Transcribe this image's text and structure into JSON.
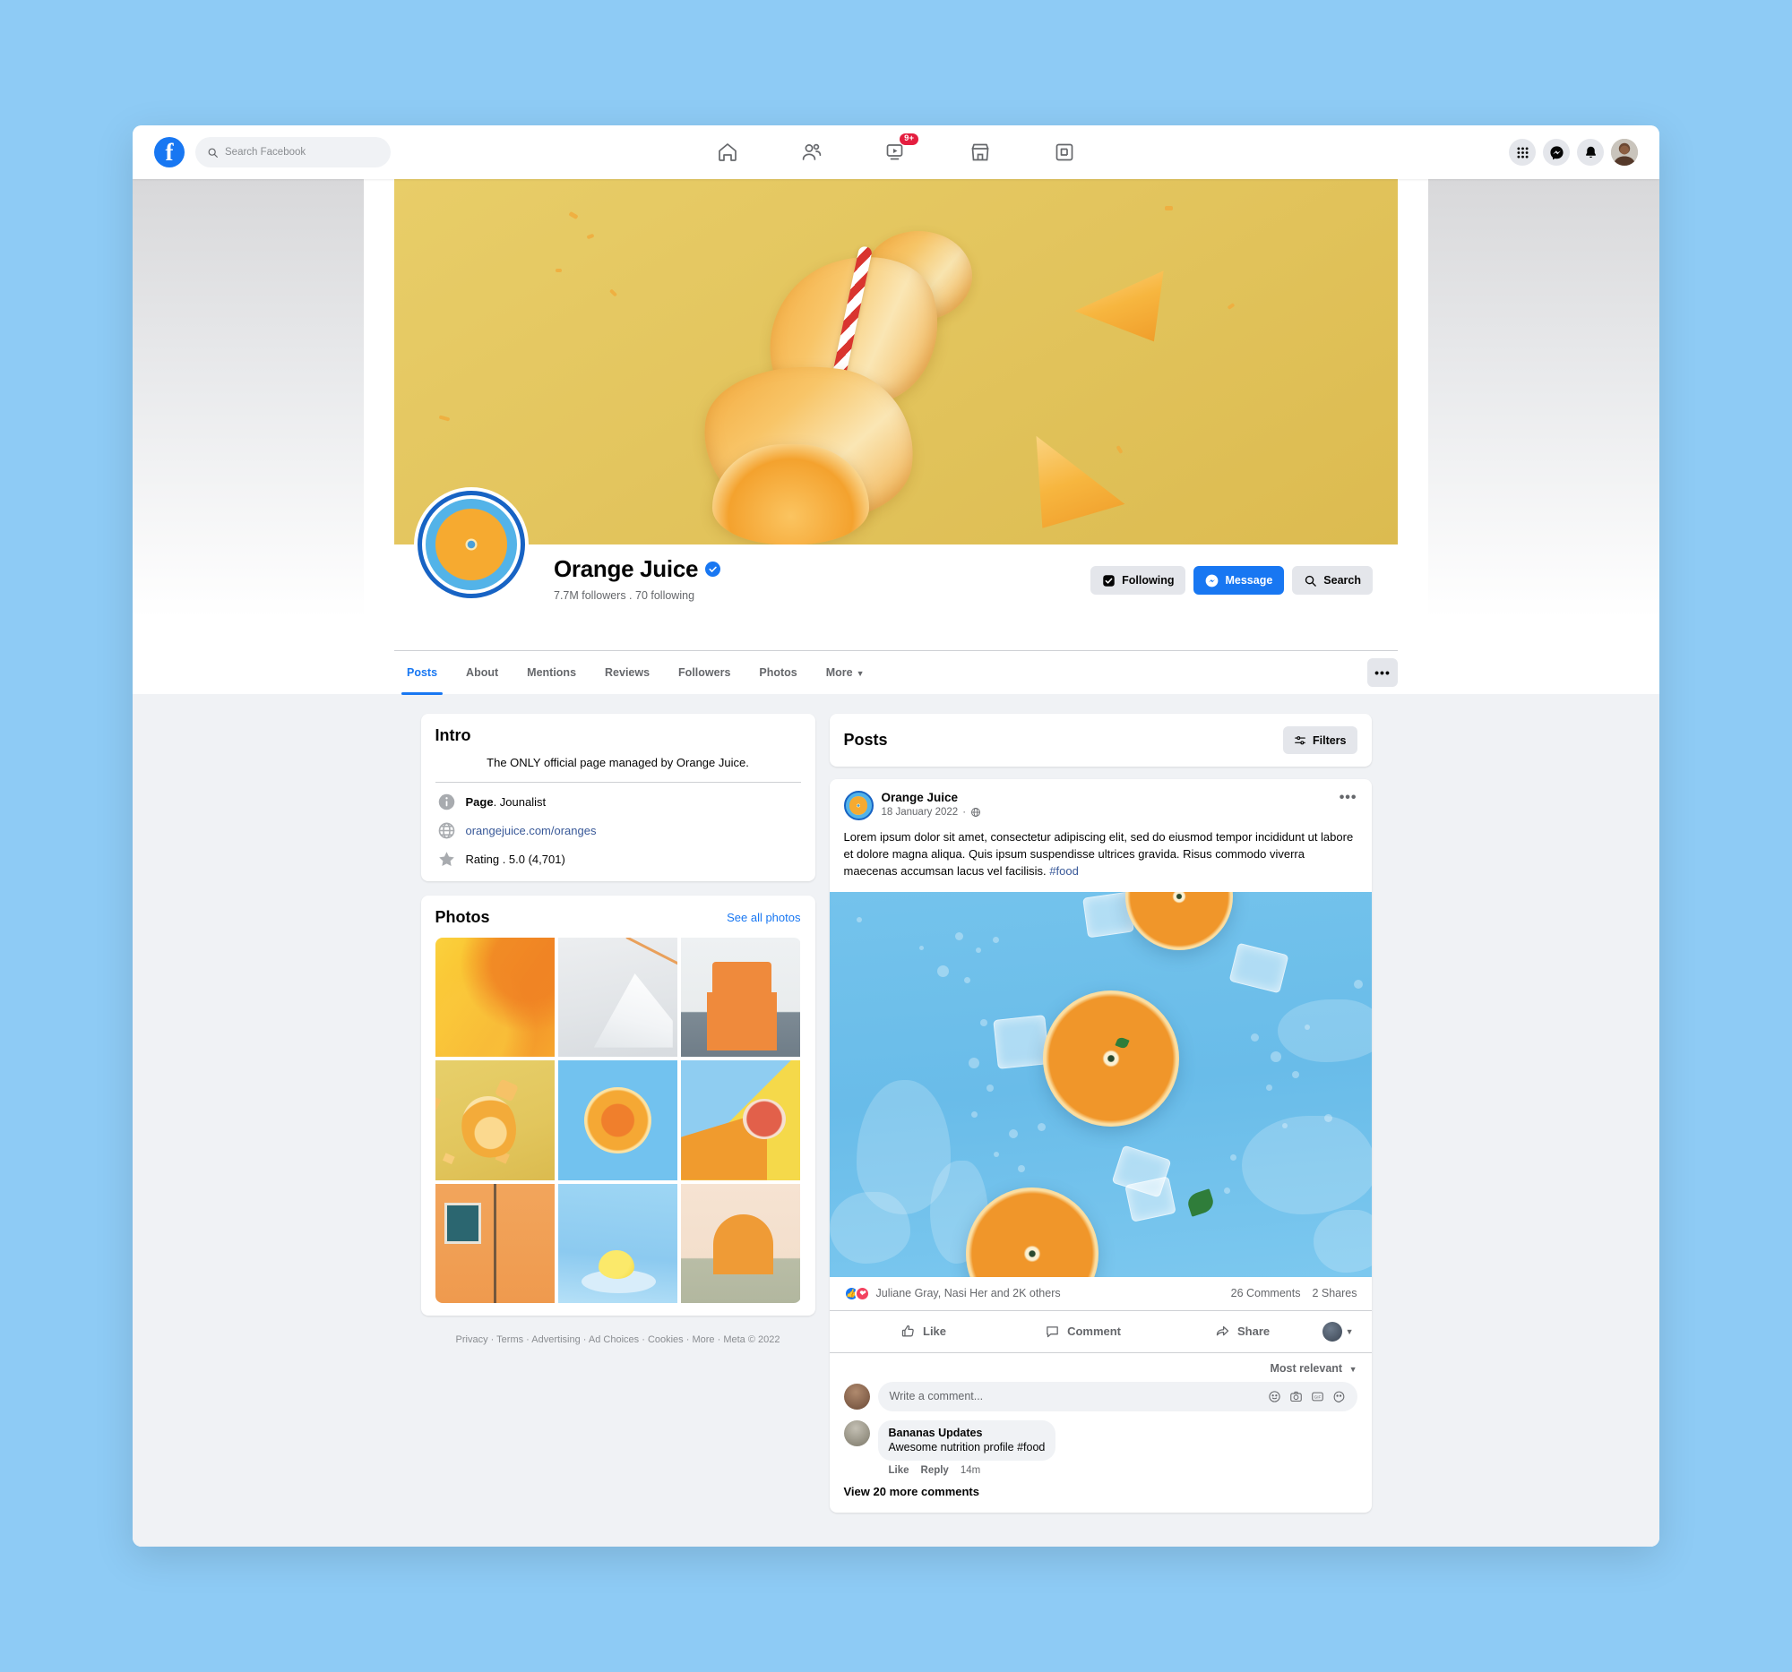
{
  "topbar": {
    "logo": "facebook-logo",
    "search_placeholder": "Search Facebook",
    "nav": [
      {
        "name": "home",
        "icon": "home-icon",
        "badge": ""
      },
      {
        "name": "friends",
        "icon": "friends-icon",
        "badge": ""
      },
      {
        "name": "watch",
        "icon": "video-icon",
        "badge": "9+"
      },
      {
        "name": "marketplace",
        "icon": "marketplace-icon",
        "badge": ""
      },
      {
        "name": "groups",
        "icon": "groups-icon",
        "badge": ""
      }
    ],
    "right": [
      {
        "name": "menu",
        "icon": "grid-menu-icon"
      },
      {
        "name": "messenger",
        "icon": "messenger-icon"
      },
      {
        "name": "notifications",
        "icon": "bell-icon"
      },
      {
        "name": "account",
        "icon": "user-avatar"
      }
    ]
  },
  "profile": {
    "name": "Orange Juice",
    "verified": true,
    "stats": "7.7M followers . 70 following",
    "buttons": {
      "following": "Following",
      "message": "Message",
      "search": "Search",
      "more": "•••"
    }
  },
  "tabs": [
    {
      "label": "Posts",
      "active": true
    },
    {
      "label": "About",
      "active": false
    },
    {
      "label": "Mentions",
      "active": false
    },
    {
      "label": "Reviews",
      "active": false
    },
    {
      "label": "Followers",
      "active": false
    },
    {
      "label": "Photos",
      "active": false
    },
    {
      "label": "More",
      "active": false,
      "caret": true
    }
  ],
  "intro": {
    "title": "Intro",
    "bio": "The ONLY official page managed by Orange Juice.",
    "category_bold": "Page",
    "category_rest": ". Jounalist",
    "website": "orangejuice.com/oranges",
    "rating": "Rating . 5.0 (4,701)"
  },
  "photos": {
    "title": "Photos",
    "see_all": "See all photos",
    "items": [
      "orange-juice-splash",
      "white-staircase-orange-railing",
      "orange-armchair",
      "orange-peel-straw-yellow",
      "orange-slice-blue",
      "grapefruit-half-yellow",
      "orange-building-teal-shutters",
      "lemon-on-plate-blue",
      "orange-semicircle-abstract"
    ]
  },
  "footer": {
    "links": [
      "Privacy",
      "Terms",
      "Advertising",
      "Ad Choices",
      "Cookies",
      "More"
    ],
    "copyright": "Meta © 2022"
  },
  "posts_panel": {
    "title": "Posts",
    "filters_label": "Filters"
  },
  "post": {
    "author": "Orange Juice",
    "date": "18 January 2022",
    "privacy": "public-globe-icon",
    "menu": "•••",
    "body": "Lorem ipsum dolor sit amet, consectetur adipiscing elit, sed do eiusmod tempor incididunt ut labore et dolore magna aliqua. Quis ipsum suspendisse ultrices gravida. Risus commodo viverra maecenas accumsan lacus vel facilisis. ",
    "hashtag": "#food",
    "image_alt": "orange-slices-ice-cubes-blue-water",
    "reactions_text": "Juliane Gray, Nasi Her and 2K others",
    "comments_count": "26 Comments",
    "shares_count": "2 Shares",
    "actions": {
      "like": "Like",
      "comment": "Comment",
      "share": "Share"
    },
    "sort": "Most relevant",
    "compose_placeholder": "Write a comment...",
    "compose_icons": [
      "emoji-icon",
      "camera-icon",
      "gif-icon",
      "sticker-icon"
    ],
    "comments": [
      {
        "author": "Bananas Updates",
        "text": "Awesome nutrition profile #food",
        "like": "Like",
        "reply": "Reply",
        "time": "14m"
      }
    ],
    "view_more": "View 20 more comments"
  },
  "colors": {
    "brand_blue": "#1877f2",
    "page_bg": "#f0f2f5",
    "cover_yellow": "#e3c55e",
    "post_image_blue": "#72c2ef",
    "badge_red": "#e41e3f",
    "desktop_bg": "#8ecbf5"
  }
}
